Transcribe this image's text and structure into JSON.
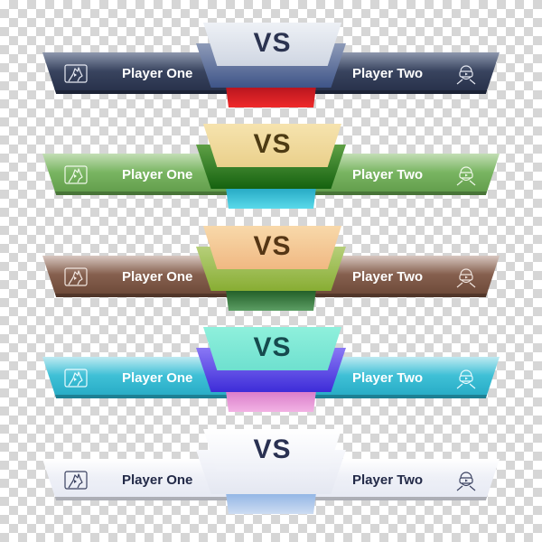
{
  "vs_label": "VS",
  "banners": [
    {
      "theme": "navy",
      "player_left": "Player One",
      "player_right": "Player Two",
      "left_icon": "fox-play-icon",
      "right_icon": "vr-headset-person-icon",
      "colors": {
        "bar_top": "#8d97ad",
        "bar_mid": "#39445f",
        "bar_bottom": "#252e47",
        "text": "#ffffff",
        "icon": "#e6e9f2",
        "top_plate_top": "#eef1f6",
        "top_plate_bottom": "#cfd6e2",
        "mid_plate_top": "#8e9bb8",
        "mid_plate_bottom": "#3e5488",
        "bottom_plate_top": "#b5141e",
        "bottom_plate_bottom": "#ef2a2a",
        "vs_text": "#2b3350"
      }
    },
    {
      "theme": "green",
      "player_left": "Player One",
      "player_right": "Player Two",
      "left_icon": "fox-play-icon",
      "right_icon": "vr-headset-person-icon",
      "colors": {
        "bar_top": "#c3deb5",
        "bar_mid": "#79b562",
        "bar_bottom": "#5f9a49",
        "text": "#ffffff",
        "icon": "#f0f8ea",
        "top_plate_top": "#f6e3ae",
        "top_plate_bottom": "#ead08b",
        "mid_plate_top": "#5fa046",
        "mid_plate_bottom": "#15620f",
        "bottom_plate_top": "#23a7c2",
        "bottom_plate_bottom": "#5ad9ea",
        "vs_text": "#4d3b14"
      }
    },
    {
      "theme": "brown",
      "player_left": "Player One",
      "player_right": "Player Two",
      "left_icon": "fox-play-icon",
      "right_icon": "vr-headset-person-icon",
      "colors": {
        "bar_top": "#d8c7c0",
        "bar_mid": "#86604f",
        "bar_bottom": "#6a4736",
        "text": "#ffffff",
        "icon": "#f1e6e0",
        "top_plate_top": "#f8d9aa",
        "top_plate_bottom": "#f0b882",
        "mid_plate_top": "#b6cf7a",
        "mid_plate_bottom": "#88ad33",
        "bottom_plate_top": "#1e5a24",
        "bottom_plate_bottom": "#5c9e64",
        "vs_text": "#553615"
      }
    },
    {
      "theme": "cyan",
      "player_left": "Player One",
      "player_right": "Player Two",
      "left_icon": "fox-play-icon",
      "right_icon": "vr-headset-person-icon",
      "colors": {
        "bar_top": "#bfeaf2",
        "bar_mid": "#3fc0d6",
        "bar_bottom": "#24a9c4",
        "text": "#ffffff",
        "icon": "#eafbff",
        "top_plate_top": "#8ff0dc",
        "top_plate_bottom": "#6ee0cf",
        "mid_plate_top": "#8a78f5",
        "mid_plate_bottom": "#3d2cd8",
        "bottom_plate_top": "#d879c8",
        "bottom_plate_bottom": "#f2b3e4",
        "vs_text": "#164a4e"
      }
    },
    {
      "theme": "white",
      "player_left": "Player One",
      "player_right": "Player Two",
      "left_icon": "fox-play-icon",
      "right_icon": "vr-headset-person-icon",
      "colors": {
        "bar_top": "#ffffff",
        "bar_mid": "#eef0f7",
        "bar_bottom": "#e6e9f3",
        "text": "#232a48",
        "icon": "#3a4160",
        "top_plate_top": "#ffffff",
        "top_plate_bottom": "#eef0f7",
        "mid_plate_top": "#f7f8fc",
        "mid_plate_bottom": "#e4e7f1",
        "bottom_plate_top": "#8fb3e4",
        "bottom_plate_bottom": "#cddcf2",
        "vs_text": "#2a3152"
      }
    }
  ]
}
